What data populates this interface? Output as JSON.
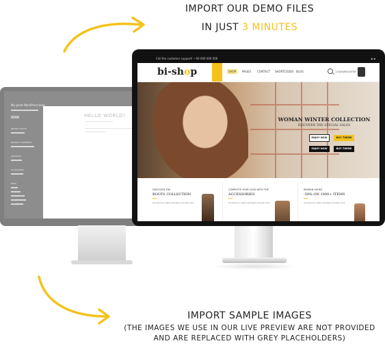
{
  "captions": {
    "top_line1": "Import our demo files",
    "top_line2_prefix": "in just ",
    "top_line2_highlight": "3 minutes",
    "bottom_line1": "Import sample images",
    "bottom_line2": "(The images we use in our live preview are not provided",
    "bottom_line3": "and are replaced with grey placeholders)"
  },
  "back_screen": {
    "site_title": "My great WordPress blog",
    "post_title": "HELLO WORLD!",
    "sidebar_headings": [
      "RECENT POSTS",
      "RECENT COMMENTS",
      "ARCHIVES",
      "CATEGORIES",
      "META"
    ]
  },
  "front_screen": {
    "topbar_text": "Call the customer support!  •  00 000 000 000",
    "logo_prefix": "bi-sh",
    "logo_highlight": "o",
    "logo_suffix": "p",
    "nav": [
      "SHOP",
      "PAGES",
      "CONTACT",
      "SHORTCODES",
      "BLOG"
    ],
    "login_text": "LOGIN/REGISTER",
    "hero": {
      "title": "WOMAN WINTER COLLECTION",
      "subtitle": "DISCOVER THE SPECIAL SALES",
      "buttons": [
        "ENJOY NOW",
        "BUY THEME",
        "ENJOY NOW",
        "BUY THEME"
      ]
    },
    "columns": [
      {
        "kicker": "DISCOVER THE",
        "heading": "BOOTS COLLECTION",
        "text": "Clockpunk! malus eomapre laoreet caos"
      },
      {
        "kicker": "COMPLETE YOUR LOOK WITH THE",
        "heading": "ACCESSORIES",
        "text": "Clockpunk! malus eomapre laoreet caos"
      },
      {
        "kicker": "WOMAN SHOES",
        "heading": "-50% ON 1000+ ITEMS",
        "text": "Clockpunk! malus eomapre laoreet caos"
      }
    ]
  },
  "colors": {
    "accent": "#f4c21b",
    "bezel": "#121212",
    "placeholder_grey": "#8d8d8d"
  }
}
